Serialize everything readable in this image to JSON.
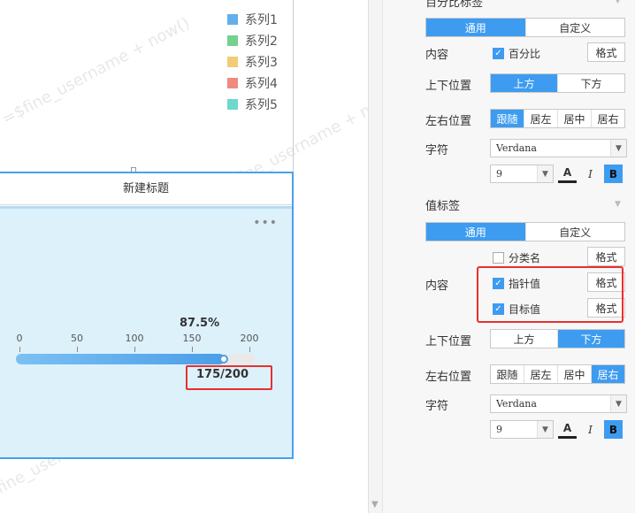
{
  "canvas": {
    "legend": [
      {
        "label": "系列1",
        "color": "#62b0ec"
      },
      {
        "label": "系列2",
        "color": "#75d28d"
      },
      {
        "label": "系列3",
        "color": "#f2cb76"
      },
      {
        "label": "系列4",
        "color": "#f08a7f"
      },
      {
        "label": "系列5",
        "color": "#6ed8cd"
      }
    ],
    "watermark": "=$fine_username + now()",
    "widget": {
      "title": "新建标题",
      "more": "•••",
      "percent": "87.5%",
      "ticks": [
        "0",
        "50",
        "100",
        "150",
        "200"
      ],
      "progress": 0.875,
      "value_text": "175/200"
    }
  },
  "panel": {
    "percent_section_title": "百分比标签",
    "value_section_title": "值标签",
    "tabs_general": "通用",
    "tabs_custom": "自定义",
    "labels": {
      "content": "内容",
      "vertical_pos": "上下位置",
      "horizontal_pos": "左右位置",
      "font": "字符"
    },
    "percent_section": {
      "checkbox": "百分比",
      "format": "格式",
      "vertical": [
        "上方",
        "下方"
      ],
      "horizontal": [
        "跟随",
        "居左",
        "居中",
        "居右"
      ],
      "font_name": "Verdana",
      "font_size": "9"
    },
    "value_section": {
      "category": "分类名",
      "pointer": "指针值",
      "target": "目标值",
      "format": "格式",
      "vertical": [
        "上方",
        "下方"
      ],
      "horizontal": [
        "跟随",
        "居左",
        "居中",
        "居右"
      ],
      "font_name": "Verdana",
      "font_size": "9"
    },
    "font_color_glyph": "A",
    "italic_glyph": "I",
    "bold_glyph": "B",
    "accent": "#3e9cf0"
  }
}
